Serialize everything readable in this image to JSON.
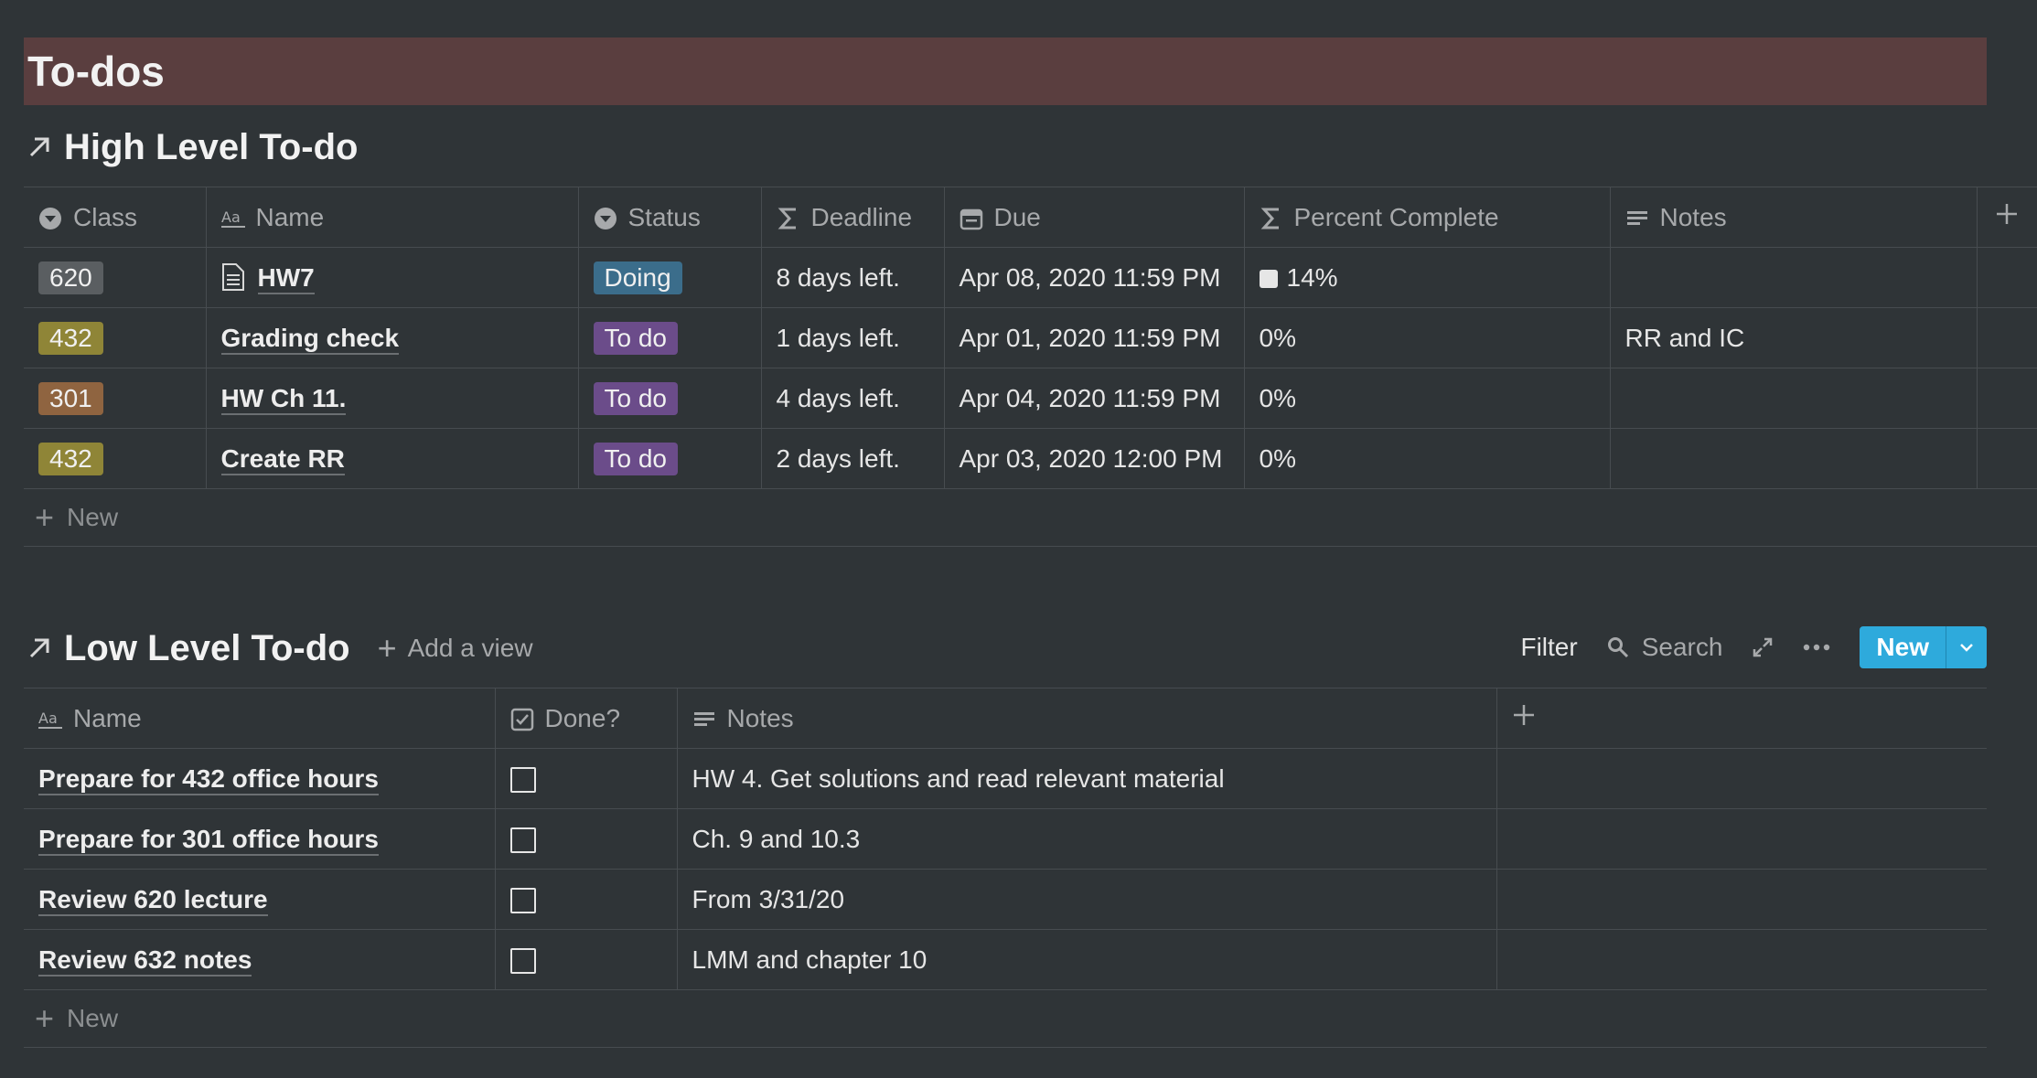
{
  "page": {
    "title": "To-dos"
  },
  "high": {
    "title": "High Level To-do",
    "columns": [
      "Class",
      "Name",
      "Status",
      "Deadline",
      "Due",
      "Percent Complete",
      "Notes"
    ],
    "rows": [
      {
        "class": "620",
        "class_color": "#5a5e61",
        "name": "HW7",
        "has_doc": true,
        "status": "Doing",
        "status_color": "#3b6d8b",
        "deadline": "8 days left.",
        "due": "Apr 08, 2020 11:59 PM",
        "percent": "14%",
        "percent_value": 0.14,
        "notes": ""
      },
      {
        "class": "432",
        "class_color": "#8f8537",
        "name": "Grading check",
        "has_doc": false,
        "status": "To do",
        "status_color": "#6b4c8a",
        "deadline": "1 days left.",
        "due": "Apr 01, 2020 11:59 PM",
        "percent": "0%",
        "percent_value": 0,
        "notes": "RR and IC"
      },
      {
        "class": "301",
        "class_color": "#8f6440",
        "name": "HW Ch 11.",
        "has_doc": false,
        "status": "To do",
        "status_color": "#6b4c8a",
        "deadline": "4 days left.",
        "due": "Apr 04, 2020 11:59 PM",
        "percent": "0%",
        "percent_value": 0,
        "notes": ""
      },
      {
        "class": "432",
        "class_color": "#8f8537",
        "name": "Create RR",
        "has_doc": false,
        "status": "To do",
        "status_color": "#6b4c8a",
        "deadline": "2 days left.",
        "due": "Apr 03, 2020 12:00 PM",
        "percent": "0%",
        "percent_value": 0,
        "notes": ""
      }
    ],
    "new_label": "New"
  },
  "low": {
    "title": "Low Level To-do",
    "add_view": "Add a view",
    "toolbar": {
      "filter": "Filter",
      "search": "Search",
      "new": "New"
    },
    "columns": [
      "Name",
      "Done?",
      "Notes"
    ],
    "rows": [
      {
        "name": "Prepare for 432 office hours",
        "done": false,
        "notes": "HW 4. Get solutions and read relevant material"
      },
      {
        "name": "Prepare for 301 office hours",
        "done": false,
        "notes": "Ch. 9 and 10.3"
      },
      {
        "name": "Review 620 lecture",
        "done": false,
        "notes": "From 3/31/20"
      },
      {
        "name": "Review 632 notes",
        "done": false,
        "notes": "LMM and chapter 10"
      }
    ],
    "new_label": "New"
  },
  "colors": {
    "background": "#2f3437",
    "title_band": "#5a3e3f",
    "accent": "#2eaadc"
  }
}
